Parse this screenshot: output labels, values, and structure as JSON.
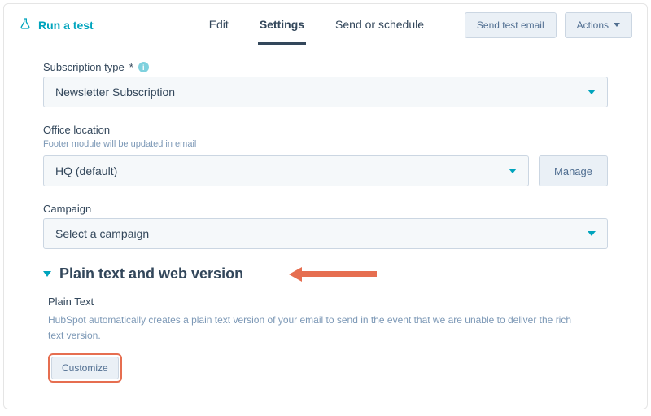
{
  "topbar": {
    "run_test_label": "Run a test",
    "tabs": [
      {
        "label": "Edit",
        "active": false
      },
      {
        "label": "Settings",
        "active": true
      },
      {
        "label": "Send or schedule",
        "active": false
      }
    ],
    "send_test_label": "Send test email",
    "actions_label": "Actions"
  },
  "subscription": {
    "label": "Subscription type",
    "required_marker": "*",
    "value": "Newsletter Subscription"
  },
  "office": {
    "label": "Office location",
    "hint": "Footer module will be updated in email",
    "value": "HQ (default)",
    "manage_label": "Manage"
  },
  "campaign": {
    "label": "Campaign",
    "value": "Select a campaign"
  },
  "plain_text_section": {
    "title": "Plain text and web version",
    "sub_title": "Plain Text",
    "description": "HubSpot automatically creates a plain text version of your email to send in the event that we are unable to deliver the rich text version.",
    "customize_label": "Customize"
  },
  "colors": {
    "accent": "#00a4bd",
    "annotation": "#e66e50"
  }
}
